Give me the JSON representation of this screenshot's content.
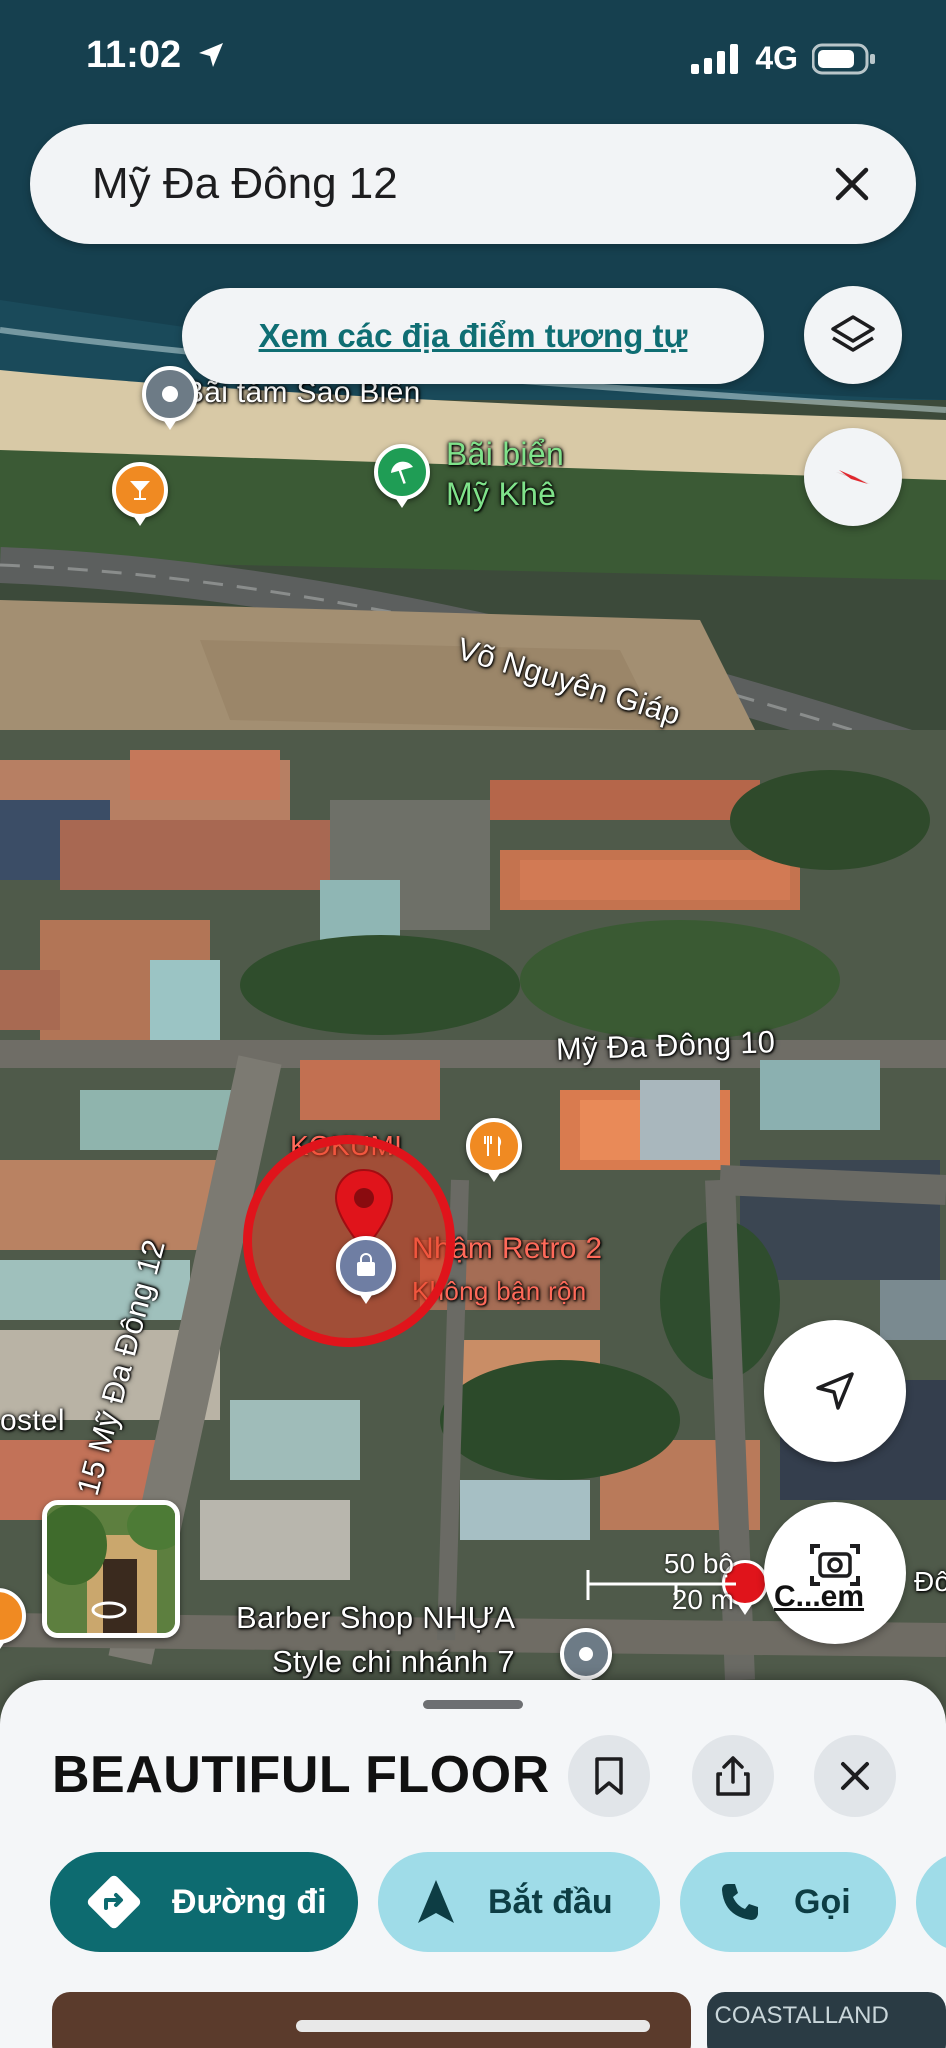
{
  "status_bar": {
    "time": "11:02",
    "network": "4G"
  },
  "search": {
    "query": "Mỹ Đa Đông 12"
  },
  "suggestion": {
    "label": "Xem các địa điểm tương tự"
  },
  "map": {
    "labels": {
      "bai_tam": "Bãi tắm Sao Biển",
      "bai_bien_line1": "Bãi biển",
      "bai_bien_line2": "Mỹ Khê",
      "vo_nguyen_giap": "Võ Nguyên Giáp",
      "my_da_dong_10": "Mỹ Đa Đông 10",
      "kokumi": "KOKUMI",
      "nham_retro": "Nhậm Retro 2",
      "khong_ban_ron": "Không bận rộn",
      "my_da_dong_12_road": "15 Mỹ Đa Đông 12",
      "hostel": "ostel",
      "barber_line1": "Barber Shop NHỰA",
      "barber_line2": "Style chi nhánh 7",
      "don": "Đôn"
    },
    "scale": {
      "imperial": "50 bộ",
      "metric": "20 m"
    },
    "camera_label": "C...em"
  },
  "place": {
    "title": "BEAUTIFUL FLOOR"
  },
  "actions": {
    "directions": "Đường đi",
    "start": "Bắt đầu",
    "call": "Gọi"
  },
  "photo_watermark": "COASTALLAND",
  "colors": {
    "primary": "#0d6b70",
    "secondary": "#9fdce8",
    "pin_red": "#e0141b"
  }
}
